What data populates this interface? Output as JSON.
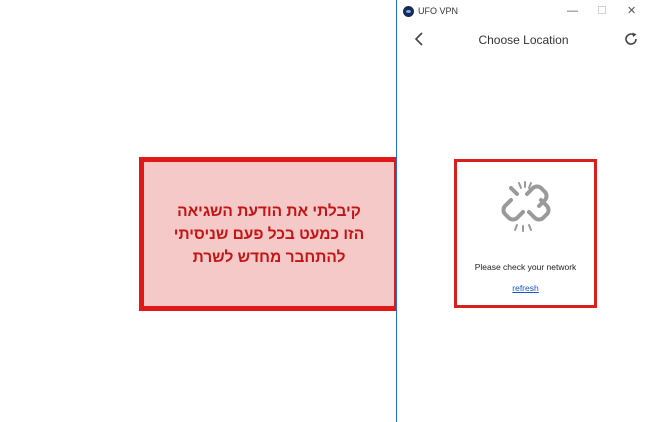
{
  "window": {
    "app_title": "UFO VPN",
    "controls": {
      "minimize": "—",
      "maximize": "☐",
      "close": "✕"
    }
  },
  "header": {
    "title": "Choose Location"
  },
  "error": {
    "message": "Please check your network",
    "refresh_label": "refresh"
  },
  "annotation": {
    "lines": [
      "קיבלתי את הודעת השגיאה",
      "הזו כמעט בכל פעם שניסיתי",
      "להתחבר מחדש לשרת"
    ]
  },
  "colors": {
    "highlight": "#e01818",
    "annotation_bg": "#f6c9c9",
    "link": "#1a55c9",
    "window_border": "#1f6fd1"
  }
}
